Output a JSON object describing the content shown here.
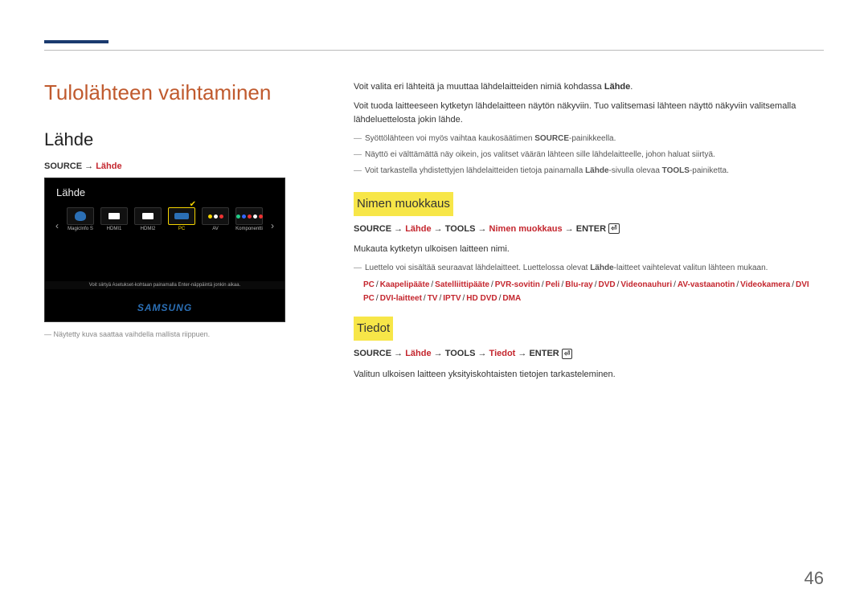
{
  "page_number": "46",
  "left": {
    "main_title": "Tulolähteen vaihtaminen",
    "subhead": "Lähde",
    "breadcrumb_source": "SOURCE",
    "breadcrumb_arrow": " → ",
    "breadcrumb_target": "Lähde",
    "tvshot": {
      "title": "Lähde",
      "items": [
        {
          "label": "MagicInfo S",
          "selected": false,
          "icon": "cloud"
        },
        {
          "label": "HDMI1",
          "selected": false,
          "icon": "port"
        },
        {
          "label": "HDMI2",
          "selected": false,
          "icon": "port"
        },
        {
          "label": "PC",
          "selected": true,
          "icon": "vga"
        },
        {
          "label": "AV",
          "selected": false,
          "icon": "rca3"
        },
        {
          "label": "Komponentti",
          "selected": false,
          "icon": "rca5"
        }
      ],
      "hint": "Voit siirtyä Asetukset-kohtaan painamalla Enter-näppäintä jonkin aikaa.",
      "logo": "SAMSUNG"
    },
    "footnote": "Näytetty kuva saattaa vaihdella mallista riippuen."
  },
  "right": {
    "intro1_pre": "Voit valita eri lähteitä ja muuttaa lähdelaitteiden nimiä kohdassa ",
    "intro1_bold": "Lähde",
    "intro1_post": ".",
    "intro2": "Voit tuoda laitteeseen kytketyn lähdelaitteen näytön näkyviin. Tuo valitsemasi lähteen näyttö näkyviin valitsemalla lähdeluettelosta jokin lähde.",
    "dash1_pre": "Syöttölähteen voi myös vaihtaa kaukosäätimen ",
    "dash1_bold": "SOURCE",
    "dash1_post": "-painikkeella.",
    "dash2": "Näyttö ei välttämättä näy oikein, jos valitset väärän lähteen sille lähdelaitteelle, johon haluat siirtyä.",
    "dash3_pre": "Voit tarkastella yhdistettyjen lähdelaitteiden tietoja painamalla ",
    "dash3_mid": "Lähde",
    "dash3_mid2": "-sivulla olevaa ",
    "dash3_bold": "TOOLS",
    "dash3_post": "-painiketta.",
    "sec1": {
      "title": "Nimen muokkaus",
      "bc": {
        "p1": "SOURCE",
        "a": " → ",
        "p2": "Lähde",
        "p3": "TOOLS",
        "p4": "Nimen muokkaus",
        "p5": "ENTER"
      },
      "text1": "Mukauta kytketyn ulkoisen laitteen nimi.",
      "dash_pre": "Luettelo voi sisältää seuraavat lähdelaitteet. Luettelossa olevat ",
      "dash_mid": "Lähde",
      "dash_post": "-laitteet vaihtelevat valitun lähteen mukaan.",
      "devices": [
        "PC",
        "Kaapelipääte",
        "Satelliittipääte",
        "PVR-sovitin",
        "Peli",
        "Blu-ray",
        "DVD",
        "Videonauhuri",
        "AV-vastaanotin",
        "Videokamera",
        "DVI PC",
        "DVI-laitteet",
        "TV",
        "IPTV",
        "HD DVD",
        "DMA"
      ]
    },
    "sec2": {
      "title": "Tiedot",
      "bc": {
        "p1": "SOURCE",
        "a": " → ",
        "p2": "Lähde",
        "p3": "TOOLS",
        "p4": "Tiedot",
        "p5": "ENTER"
      },
      "text1": "Valitun ulkoisen laitteen yksityiskohtaisten tietojen tarkasteleminen."
    }
  }
}
